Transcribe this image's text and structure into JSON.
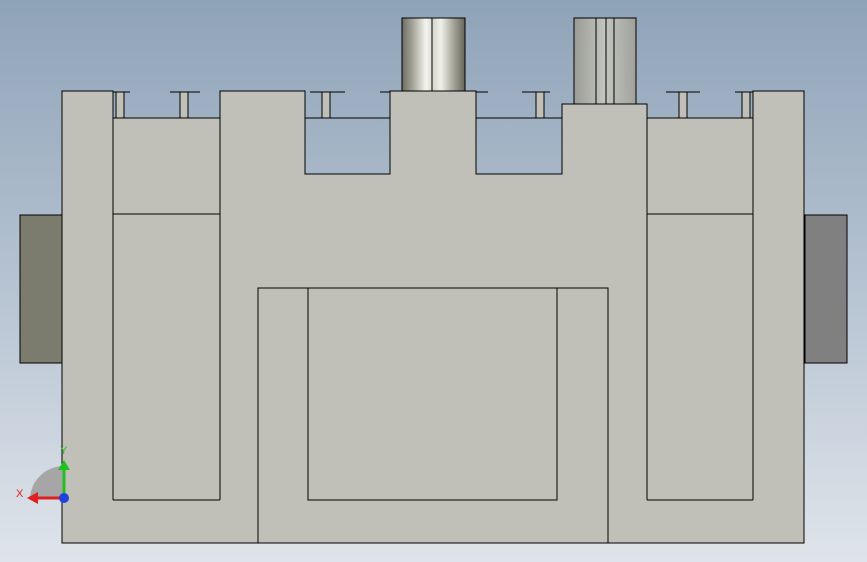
{
  "viewport": {
    "background_top": "#8fa3b8",
    "background_bottom": "#dfe4ea"
  },
  "model": {
    "body_fill": "#c0c0b8",
    "edge_color": "#000000",
    "side_block_left_fill": "#7c7c6e",
    "side_block_right_fill": "#808080"
  },
  "triad": {
    "x_label": "X",
    "y_label": "Y",
    "x_color": "#e02020",
    "y_color": "#20c020",
    "z_color": "#2040e0"
  }
}
